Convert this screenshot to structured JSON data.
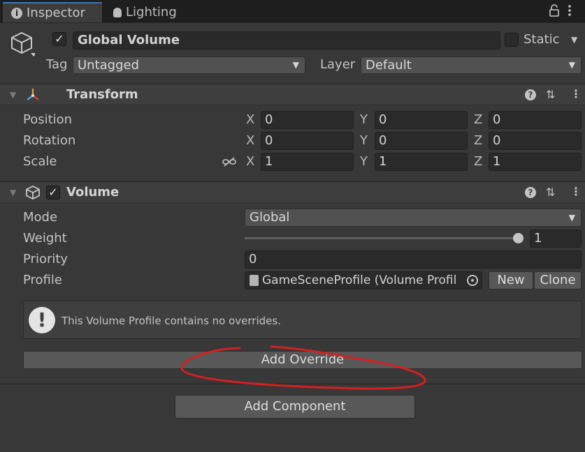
{
  "tabs": [
    {
      "label": "Inspector",
      "icon": "info-icon",
      "active": true
    },
    {
      "label": "Lighting",
      "icon": "lightbulb-icon",
      "active": false
    }
  ],
  "gameobject": {
    "name": "Global Volume",
    "active": true,
    "static_label": "Static",
    "static": false,
    "tag_label": "Tag",
    "tag_value": "Untagged",
    "layer_label": "Layer",
    "layer_value": "Default"
  },
  "transform": {
    "title": "Transform",
    "position_label": "Position",
    "rotation_label": "Rotation",
    "scale_label": "Scale",
    "axes": {
      "x": "X",
      "y": "Y",
      "z": "Z"
    },
    "position": {
      "x": "0",
      "y": "0",
      "z": "0"
    },
    "rotation": {
      "x": "0",
      "y": "0",
      "z": "0"
    },
    "scale": {
      "x": "1",
      "y": "1",
      "z": "1"
    }
  },
  "volume": {
    "title": "Volume",
    "enabled": true,
    "mode_label": "Mode",
    "mode_value": "Global",
    "weight_label": "Weight",
    "weight_value": "1",
    "weight_fraction": 1.0,
    "priority_label": "Priority",
    "priority_value": "0",
    "profile_label": "Profile",
    "profile_value": "GameSceneProfile (Volume Profil",
    "new_label": "New",
    "clone_label": "Clone",
    "help_text": "This Volume Profile contains no overrides.",
    "add_override_label": "Add Override"
  },
  "add_component_label": "Add Component",
  "colors": {
    "panel_bg": "#383838",
    "annotation": "#d42020",
    "active_tab_accent": "#3a79bb"
  }
}
